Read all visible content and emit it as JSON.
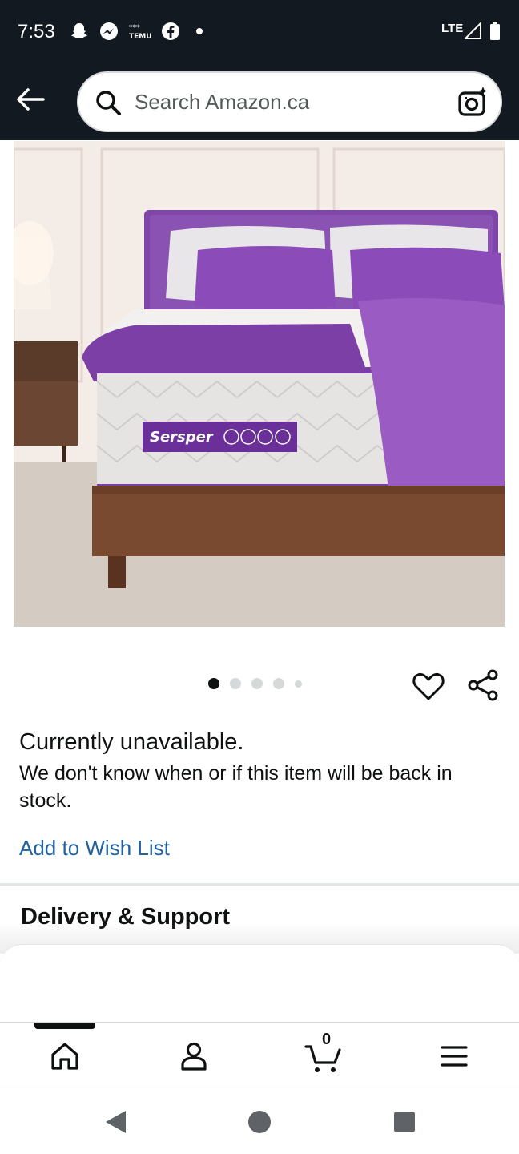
{
  "status_bar": {
    "time": "7:53",
    "network": "LTE",
    "notification_icons": [
      "snapchat-icon",
      "messenger-icon",
      "temu-icon",
      "facebook-icon",
      "dot-icon"
    ]
  },
  "header": {
    "back_icon": "back-arrow-icon",
    "search_placeholder": "Search Amazon.ca",
    "search_icon": "search-icon",
    "camera_icon": "camera-search-icon"
  },
  "product": {
    "image_alt": "purple-mattress-bed-icon",
    "brand_on_image": "Sersper",
    "carousel": {
      "total": 5,
      "active_index": 0
    }
  },
  "availability": {
    "title": "Currently unavailable.",
    "message": "We don't know when or if this item will be back in stock.",
    "wish_link": "Add to Wish List"
  },
  "section": {
    "delivery_title": "Delivery & Support"
  },
  "bottom_nav": {
    "items": [
      "home-icon",
      "account-icon",
      "cart-icon",
      "menu-icon"
    ],
    "cart_count": "0",
    "active": "home-icon"
  },
  "system_nav": [
    "back-triangle-icon",
    "home-circle-icon",
    "recents-square-icon"
  ],
  "colors": {
    "header_bg": "#131921",
    "link": "#2162a1",
    "text": "#0f1111",
    "purple": "#7b3fa6"
  }
}
